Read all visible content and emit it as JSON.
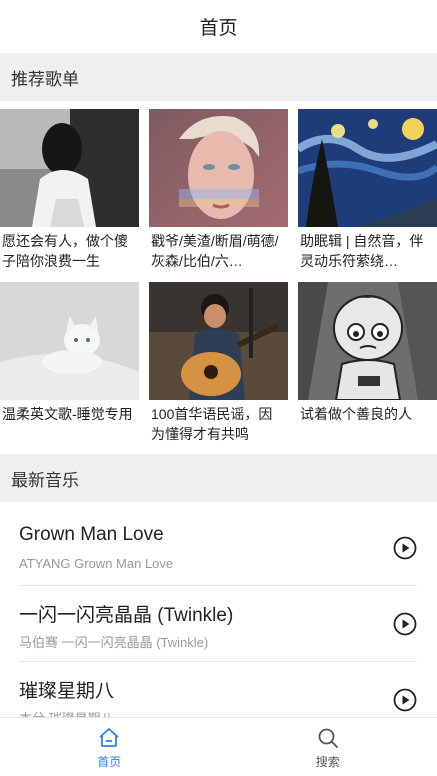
{
  "header": {
    "title": "首页"
  },
  "sections": {
    "recommend": "推荐歌单",
    "newest": "最新音乐"
  },
  "playlists": [
    {
      "name": "愿还会有人，做个傻子陪你浪费一生",
      "cover": "girl-back-photo"
    },
    {
      "name": "戳爷/美渣/断眉/萌德/灰森/比伯/六…",
      "cover": "portrait-photo"
    },
    {
      "name": "助眠辑 | 自然音，伴灵动乐符萦绕…",
      "cover": "starry-night-painting"
    },
    {
      "name": "温柔英文歌-睡觉专用",
      "cover": "white-kitten-photo"
    },
    {
      "name": "100首华语民谣，因为懂得才有共鸣",
      "cover": "guitarist-photo"
    },
    {
      "name": "试着做个善良的人",
      "cover": "cartoon-boy-drawing"
    }
  ],
  "songs": [
    {
      "title": "Grown Man Love",
      "subtitle": "ATYANG Grown Man Love"
    },
    {
      "title": "一闪一闪亮晶晶 (Twinkle)",
      "subtitle": "马伯骞 一闪一闪亮晶晶 (Twinkle)"
    },
    {
      "title": "璀璨星期八",
      "subtitle": "本兮 璀璨星期八"
    }
  ],
  "tabbar": {
    "home": "首页",
    "search": "搜索"
  },
  "colors": {
    "accent": "#2d7ef7",
    "section_bg": "#efefef"
  },
  "icons": {
    "play": "play-circle-icon",
    "home": "home-icon",
    "search": "search-icon"
  }
}
